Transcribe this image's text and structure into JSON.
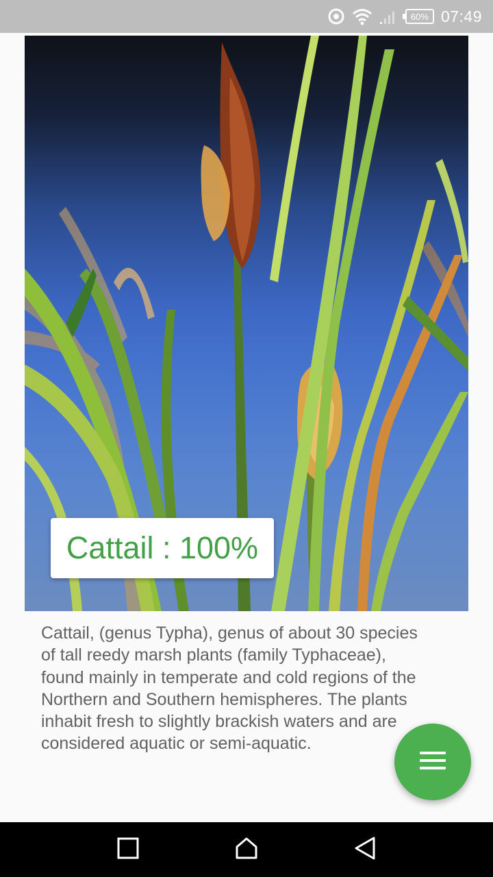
{
  "status_bar": {
    "battery": "60%",
    "time": "07:49"
  },
  "result": {
    "label": "Cattail : 100%",
    "color": "#43a047"
  },
  "description": "Cattail, (genus Typha), genus of about 30 species of tall reedy marsh plants (family Typhaceae), found mainly in temperate and cold regions of the Northern and Southern hemispheres. The plants inhabit fresh to slightly brackish waters and are considered aquatic or semi-aquatic.",
  "fab": {
    "icon": "menu-icon",
    "color": "#4caf50"
  },
  "navigation": {
    "recents_icon": "square-icon",
    "home_icon": "home-icon",
    "back_icon": "back-triangle-icon"
  }
}
